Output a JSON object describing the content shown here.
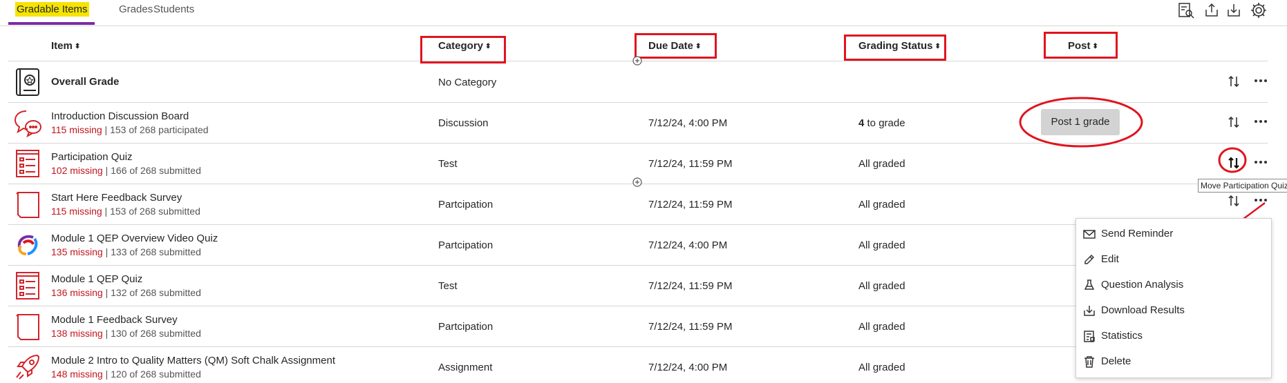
{
  "tabs": [
    {
      "label": "Gradable Items",
      "active": true
    },
    {
      "label": "Grades",
      "active": false
    },
    {
      "label": "Students",
      "active": false
    }
  ],
  "toolbar_icons": [
    "search-document-icon",
    "upload-icon",
    "download-icon",
    "gear-icon"
  ],
  "columns": {
    "item": "Item",
    "category": "Category",
    "due_date": "Due Date",
    "grading_status": "Grading Status",
    "post": "Post",
    "sort_glyph": "⬍"
  },
  "rows": [
    {
      "icon": "overall-grade-icon",
      "title": "Overall Grade",
      "missing": "",
      "submitted": "",
      "category": "No Category",
      "due": "",
      "status_count": "",
      "status": ""
    },
    {
      "icon": "discussion-icon",
      "title": "Introduction Discussion Board",
      "missing": "115 missing",
      "submitted": "153 of 268 participated",
      "category": "Discussion",
      "due": "7/12/24, 4:00 PM",
      "status_count": "4",
      "status": "to grade",
      "post": "Post 1 grade"
    },
    {
      "icon": "test-icon",
      "title": "Participation Quiz",
      "missing": "102 missing",
      "submitted": "166 of 268 submitted",
      "category": "Test",
      "due": "7/12/24, 11:59 PM",
      "status_count": "",
      "status": "All graded"
    },
    {
      "icon": "survey-icon",
      "title": "Start Here Feedback Survey",
      "missing": "115 missing",
      "submitted": "153 of 268 submitted",
      "category": "Partcipation",
      "due": "7/12/24, 11:59 PM",
      "status_count": "",
      "status": "All graded"
    },
    {
      "icon": "video-quiz-logo-icon",
      "title": "Module 1 QEP Overview Video Quiz",
      "missing": "135 missing",
      "submitted": "133 of 268 submitted",
      "category": "Partcipation",
      "due": "7/12/24, 4:00 PM",
      "status_count": "",
      "status": "All graded"
    },
    {
      "icon": "test-icon",
      "title": "Module 1 QEP Quiz",
      "missing": "136 missing",
      "submitted": "132 of 268 submitted",
      "category": "Test",
      "due": "7/12/24, 11:59 PM",
      "status_count": "",
      "status": "All graded"
    },
    {
      "icon": "survey-icon",
      "title": "Module 1 Feedback Survey",
      "missing": "138 missing",
      "submitted": "130 of 268 submitted",
      "category": "Partcipation",
      "due": "7/12/24, 11:59 PM",
      "status_count": "",
      "status": "All graded"
    },
    {
      "icon": "rocket-icon",
      "title": "Module 2 Intro to Quality Matters (QM) Soft Chalk Assignment",
      "missing": "148 missing",
      "submitted": "120 of 268 submitted",
      "category": "Assignment",
      "due": "7/12/24, 4:00 PM",
      "status_count": "",
      "status": "All graded"
    }
  ],
  "separator": " | ",
  "tooltip": "Move Participation Quiz",
  "menu": [
    {
      "icon": "envelope-icon",
      "label": "Send Reminder"
    },
    {
      "icon": "pencil-icon",
      "label": "Edit"
    },
    {
      "icon": "flask-icon",
      "label": "Question Analysis"
    },
    {
      "icon": "download-icon",
      "label": "Download Results"
    },
    {
      "icon": "statistics-icon",
      "label": "Statistics"
    },
    {
      "icon": "trash-icon",
      "label": "Delete"
    }
  ],
  "colors": {
    "accent_purple": "#7c2aa6",
    "highlight_yellow": "#f5e400",
    "annotation_red": "#e0141e",
    "missing_red": "#c0141c"
  }
}
